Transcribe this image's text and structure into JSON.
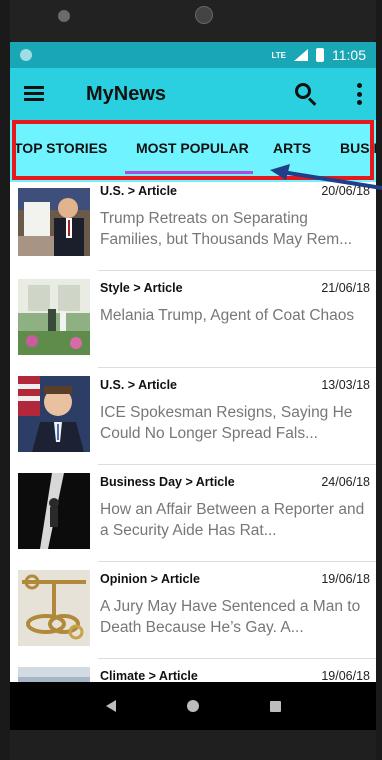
{
  "status_bar": {
    "network": "LTE",
    "time": "11:05"
  },
  "app_bar": {
    "title": "MyNews",
    "icons": [
      "menu-icon",
      "search-icon",
      "more-vert-icon"
    ]
  },
  "tabs": [
    {
      "label": "TOP STORIES",
      "selected": false
    },
    {
      "label": "MOST POPULAR",
      "selected": true
    },
    {
      "label": "ARTS",
      "selected": false
    },
    {
      "label": "BUSIN",
      "selected": false
    }
  ],
  "colors": {
    "status_bar": "#1aa7b5",
    "app_bar": "#2ad0e0",
    "tab_bar": "#6ff4ff",
    "tab_indicator": "#b04de0",
    "annotation_box": "#e5191c",
    "annotation_arrow": "#1f3f8a"
  },
  "articles": [
    {
      "category": "U.S. > Article",
      "date": "20/06/18",
      "headline": "Trump Retreats on Separating Families, but Thousands May Rem..."
    },
    {
      "category": "Style > Article",
      "date": "21/06/18",
      "headline": "Melania Trump, Agent of Coat Chaos"
    },
    {
      "category": "U.S. > Article",
      "date": "13/03/18",
      "headline": "ICE Spokesman Resigns, Saying He Could No Longer Spread Fals..."
    },
    {
      "category": "Business Day > Article",
      "date": "24/06/18",
      "headline": "How an Affair Between a Reporter and a Security Aide Has Rat..."
    },
    {
      "category": "Opinion > Article",
      "date": "19/06/18",
      "headline": "A Jury May Have Sentenced a Man to Death Because He’s Gay. A..."
    },
    {
      "category": "Climate > Article",
      "date": "19/06/18",
      "headline": ""
    }
  ]
}
